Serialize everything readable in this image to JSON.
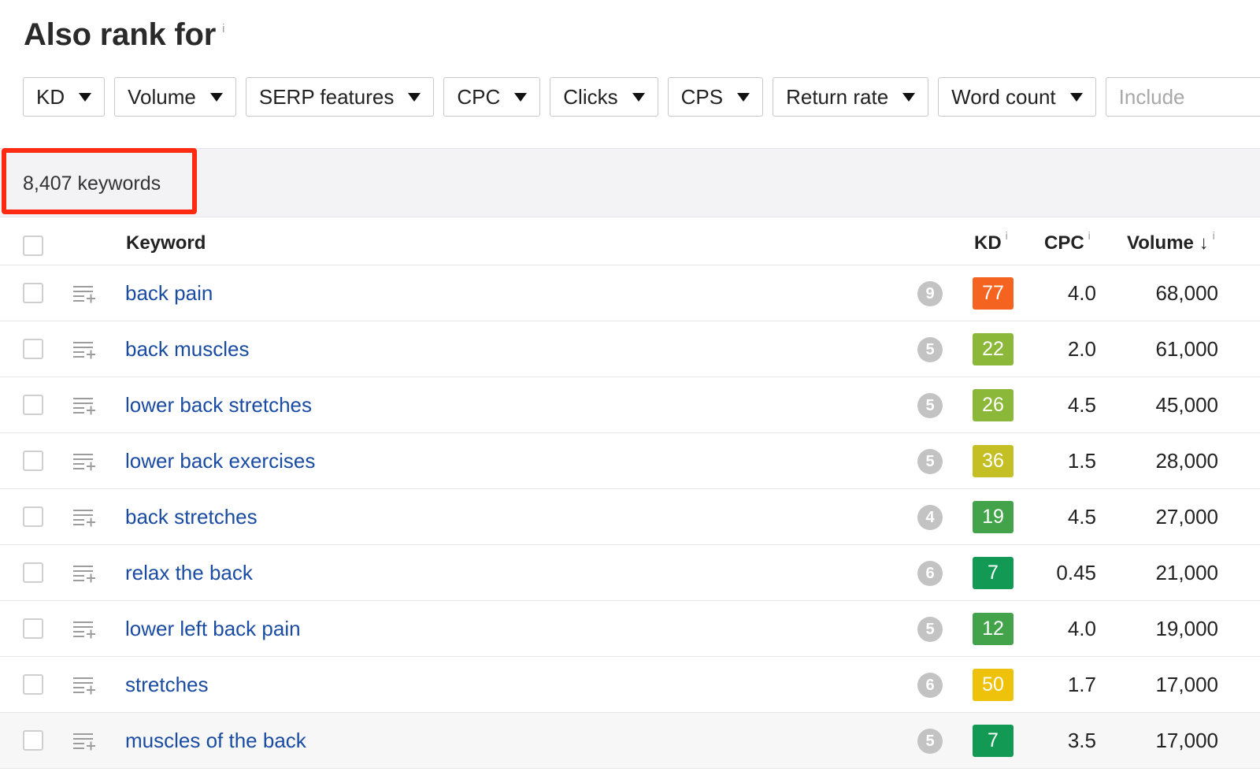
{
  "page": {
    "title": "Also rank for",
    "title_info": "i"
  },
  "filters": {
    "kd": "KD",
    "volume": "Volume",
    "serp_features": "SERP features",
    "cpc": "CPC",
    "clicks": "Clicks",
    "cps": "CPS",
    "return_rate": "Return rate",
    "word_count": "Word count",
    "include_placeholder": "Include"
  },
  "summary": {
    "count": "8,407 keywords"
  },
  "table": {
    "headers": {
      "keyword": "Keyword",
      "kd": "KD",
      "kd_info": "i",
      "cpc": "CPC",
      "cpc_info": "i",
      "volume": "Volume",
      "volume_sort": "↓",
      "volume_info": "i"
    },
    "rows": [
      {
        "keyword": "back pain",
        "serp": "9",
        "kd": "77",
        "kd_color": "#f4631f",
        "cpc": "4.0",
        "volume": "68,000"
      },
      {
        "keyword": "back muscles",
        "serp": "5",
        "kd": "22",
        "kd_color": "#8cb83a",
        "cpc": "2.0",
        "volume": "61,000"
      },
      {
        "keyword": "lower back stretches",
        "serp": "5",
        "kd": "26",
        "kd_color": "#8cb83a",
        "cpc": "4.5",
        "volume": "45,000"
      },
      {
        "keyword": "lower back exercises",
        "serp": "5",
        "kd": "36",
        "kd_color": "#c4bf24",
        "cpc": "1.5",
        "volume": "28,000"
      },
      {
        "keyword": "back stretches",
        "serp": "4",
        "kd": "19",
        "kd_color": "#43a34a",
        "cpc": "4.5",
        "volume": "27,000"
      },
      {
        "keyword": "relax the back",
        "serp": "6",
        "kd": "7",
        "kd_color": "#129a55",
        "cpc": "0.45",
        "volume": "21,000"
      },
      {
        "keyword": "lower left back pain",
        "serp": "5",
        "kd": "12",
        "kd_color": "#43a34a",
        "cpc": "4.0",
        "volume": "19,000"
      },
      {
        "keyword": "stretches",
        "serp": "6",
        "kd": "50",
        "kd_color": "#eec10a",
        "cpc": "1.7",
        "volume": "17,000"
      },
      {
        "keyword": "muscles of the back",
        "serp": "5",
        "kd": "7",
        "kd_color": "#129a55",
        "cpc": "3.5",
        "volume": "17,000"
      }
    ]
  },
  "colors": {
    "link": "#1a4ba3",
    "highlight_border": "#ff2a12"
  }
}
